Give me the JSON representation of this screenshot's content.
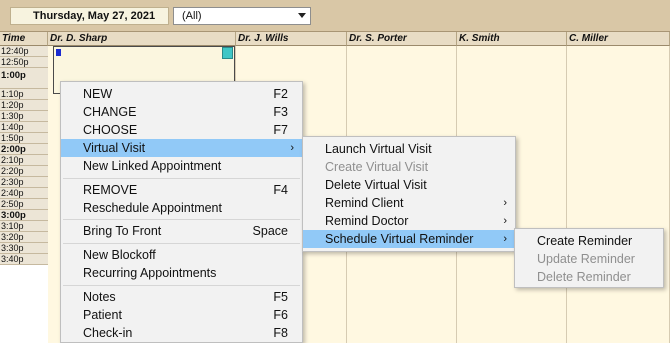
{
  "toolbar": {
    "date": "Thursday, May 27, 2021",
    "filter_value": "(All)"
  },
  "columns": [
    "Time",
    "Dr. D. Sharp",
    "Dr. J. Wills",
    "Dr. S. Porter",
    "K. Smith",
    "C. Miller"
  ],
  "times": [
    "12:40p",
    "12:50p",
    "1:00p",
    "1:10p",
    "1:20p",
    "1:30p",
    "1:40p",
    "1:50p",
    "2:00p",
    "2:10p",
    "2:20p",
    "2:30p",
    "2:40p",
    "2:50p",
    "3:00p",
    "3:10p",
    "3:20p",
    "3:30p",
    "3:40p"
  ],
  "context_menu": {
    "items": [
      {
        "label": "NEW",
        "shortcut": "F2"
      },
      {
        "label": "CHANGE",
        "shortcut": "F3"
      },
      {
        "label": "CHOOSE",
        "shortcut": "F7"
      },
      {
        "label": "Virtual Visit",
        "shortcut": "›"
      },
      {
        "label": "New Linked Appointment",
        "shortcut": ""
      },
      {
        "label": "REMOVE",
        "shortcut": "F4"
      },
      {
        "label": "Reschedule Appointment",
        "shortcut": ""
      },
      {
        "label": "Bring To Front",
        "shortcut": "Space"
      },
      {
        "label": "New Blockoff",
        "shortcut": ""
      },
      {
        "label": "Recurring Appointments",
        "shortcut": ""
      },
      {
        "label": "Notes",
        "shortcut": "F5"
      },
      {
        "label": "Patient",
        "shortcut": "F6"
      },
      {
        "label": "Check-in",
        "shortcut": "F8"
      }
    ]
  },
  "virtual_visit_menu": {
    "items": [
      {
        "label": "Launch Virtual Visit",
        "arrow": ""
      },
      {
        "label": "Create Virtual Visit",
        "arrow": ""
      },
      {
        "label": "Delete Virtual Visit",
        "arrow": ""
      },
      {
        "label": "Remind Client",
        "arrow": "›"
      },
      {
        "label": "Remind Doctor",
        "arrow": "›"
      },
      {
        "label": "Schedule Virtual Reminder",
        "arrow": "›"
      }
    ]
  },
  "reminder_menu": {
    "items": [
      {
        "label": "Create Reminder"
      },
      {
        "label": "Update Reminder"
      },
      {
        "label": "Delete Reminder"
      }
    ]
  }
}
